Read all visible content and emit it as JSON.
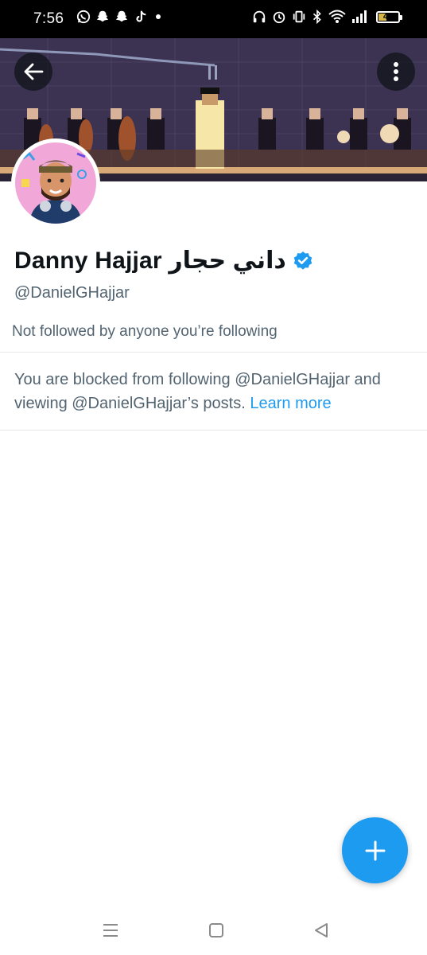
{
  "status_bar": {
    "time": "7:56",
    "battery_percent": "42",
    "battery_level": 0.42,
    "left_icons": [
      "whatsapp-icon",
      "snapchat-icon",
      "snapchat-icon",
      "tiktok-icon",
      "dot-icon"
    ],
    "right_icons": [
      "headphones-icon",
      "alarm-icon",
      "vibrate-icon",
      "bluetooth-icon",
      "wifi-icon",
      "signal-icon",
      "battery-icon"
    ]
  },
  "profile": {
    "display_name": "Danny Hajjar داني حجار",
    "handle": "@DanielGHajjar",
    "verified": true,
    "followed_note": "Not followed by anyone you’re following",
    "blocked_message": "You are blocked from following @DanielGHajjar and viewing @DanielGHajjar’s posts.",
    "learn_more": "Learn more"
  },
  "colors": {
    "accent": "#1d9bf0",
    "secondary_text": "#536471",
    "primary_text": "#0f1419",
    "banner_bg": "#3c3352"
  },
  "icons": {
    "back": "arrow-left-icon",
    "more": "more-vertical-icon",
    "verified": "verified-badge-icon",
    "compose": "plus-icon",
    "nav_recent": "menu-icon",
    "nav_home": "square-icon",
    "nav_back": "triangle-back-icon"
  }
}
